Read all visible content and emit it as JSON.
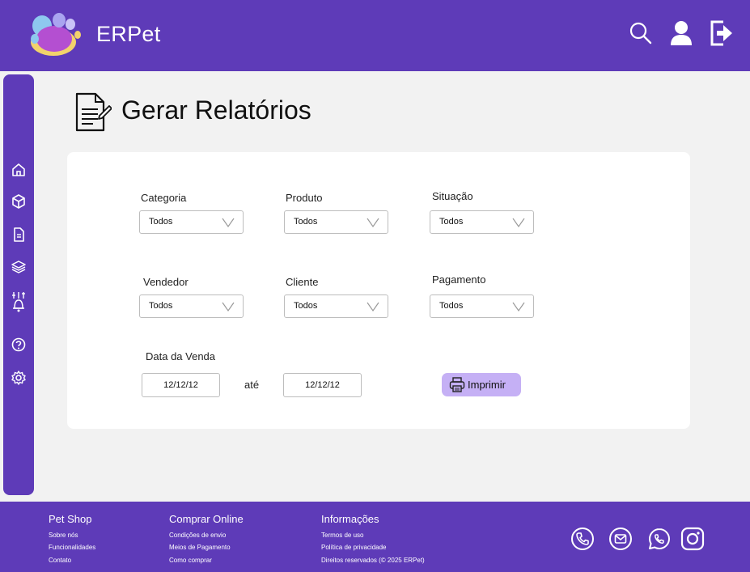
{
  "header": {
    "brand": "ERPet",
    "icons": [
      "search-icon",
      "user-icon",
      "logout-icon"
    ]
  },
  "sidebar": {
    "items": [
      {
        "icon": "home-icon"
      },
      {
        "icon": "box-icon"
      },
      {
        "icon": "document-icon"
      },
      {
        "icon": "layers-icon"
      },
      {
        "icon": "bell-sliders-icon"
      },
      {
        "icon": "help-icon"
      },
      {
        "icon": "settings-icon"
      }
    ]
  },
  "page": {
    "title": "Gerar Relatórios"
  },
  "filters": {
    "categoria": {
      "label": "Categoria",
      "value": "Todos"
    },
    "produto": {
      "label": "Produto",
      "value": "Todos"
    },
    "situacao": {
      "label": "Situação",
      "value": "Todos"
    },
    "vendedor": {
      "label": "Vendedor",
      "value": "Todos"
    },
    "cliente": {
      "label": "Cliente",
      "value": "Todos"
    },
    "pagamento": {
      "label": "Pagamento",
      "value": "Todos"
    }
  },
  "date_range": {
    "label": "Data da Venda",
    "from": "12/12/12",
    "separator": "até",
    "to": "12/12/12"
  },
  "print_button": {
    "label": "Imprimir",
    "icon": "printer-icon"
  },
  "footer": {
    "columns": [
      {
        "title": "Pet Shop",
        "links": [
          "Sobre nós",
          "Funcionalidades",
          "Contato"
        ]
      },
      {
        "title": "Comprar Online",
        "links": [
          "Condições de envio",
          "Meios de Pagamento",
          "Como comprar"
        ]
      },
      {
        "title": "Informações",
        "links": [
          "Termos de uso",
          "Política de privacidade",
          "Direitos reservados (© 2025 ERPet)"
        ]
      }
    ],
    "social": [
      "phone-icon",
      "email-icon",
      "whatsapp-icon",
      "instagram-icon"
    ]
  },
  "colors": {
    "primary": "#5e3bb8",
    "button": "#c5b0f5",
    "background": "#f2f2f2",
    "card": "#ffffff"
  }
}
